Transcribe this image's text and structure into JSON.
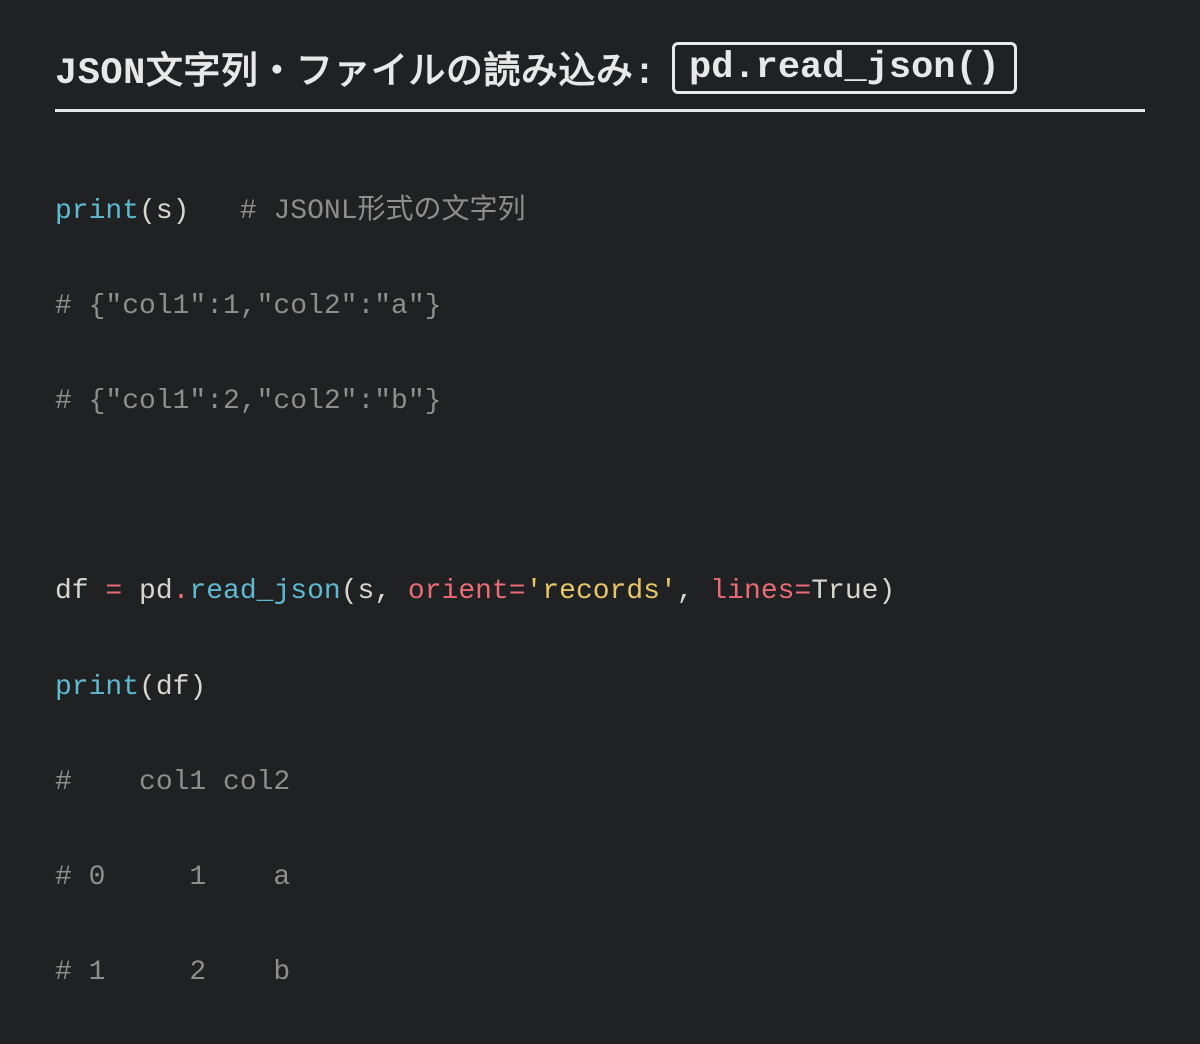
{
  "title": {
    "text": "JSON文字列・ファイルの読み込み:",
    "code": "pd.read_json()"
  },
  "code": {
    "line1": {
      "print": "print",
      "open": "(",
      "arg": "s",
      "close": ")",
      "space": "   ",
      "comment": "# JSONL形式の文字列"
    },
    "line2": "# {\"col1\":1,\"col2\":\"a\"}",
    "line3": "# {\"col1\":2,\"col2\":\"b\"}",
    "line4": "",
    "line5": {
      "var": "df",
      "eq": " = ",
      "obj": "pd",
      "dot": ".",
      "method": "read_json",
      "open": "(",
      "arg1": "s",
      "comma1": ", ",
      "kw1": "orient",
      "eq2": "=",
      "str1": "'records'",
      "comma2": ", ",
      "kw2": "lines",
      "eq3": "=",
      "val": "True",
      "close": ")"
    },
    "line6": {
      "print": "print",
      "open": "(",
      "arg": "df",
      "close": ")"
    },
    "line7": "#    col1 col2",
    "line8": "# 0     1    a",
    "line9": "# 1     2    b"
  }
}
